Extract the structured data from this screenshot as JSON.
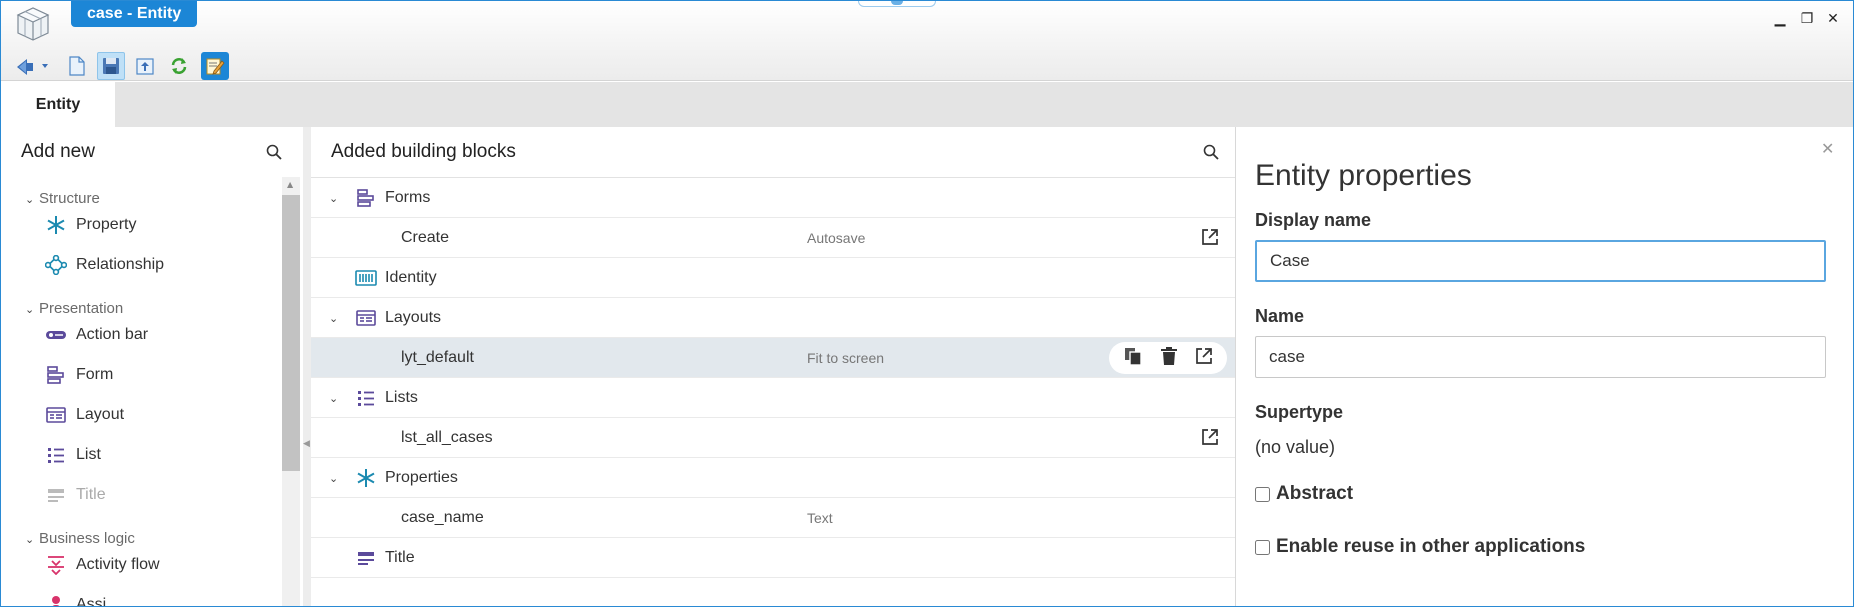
{
  "window": {
    "title": "case - Entity",
    "controls": {
      "minimize": "▁",
      "restore": "❐",
      "close": "✕"
    }
  },
  "toolbar": {
    "buttons": [
      {
        "name": "back-dropdown",
        "icon": "navigate-back-icon"
      },
      {
        "name": "new",
        "icon": "new-document-icon"
      },
      {
        "name": "save",
        "icon": "save-icon"
      },
      {
        "name": "export",
        "icon": "export-icon"
      },
      {
        "name": "refresh",
        "icon": "refresh-icon"
      },
      {
        "name": "edit",
        "icon": "edit-icon"
      }
    ]
  },
  "tabs": [
    {
      "label": "Entity",
      "active": true
    }
  ],
  "left_panel": {
    "title": "Add new",
    "sections": [
      {
        "label": "Structure",
        "items": [
          {
            "label": "Property",
            "icon": "asterisk-icon"
          },
          {
            "label": "Relationship",
            "icon": "relationship-icon"
          }
        ]
      },
      {
        "label": "Presentation",
        "items": [
          {
            "label": "Action bar",
            "icon": "action-bar-icon"
          },
          {
            "label": "Form",
            "icon": "form-icon"
          },
          {
            "label": "Layout",
            "icon": "layout-icon"
          },
          {
            "label": "List",
            "icon": "list-icon"
          },
          {
            "label": "Title",
            "icon": "title-icon",
            "disabled": true
          }
        ]
      },
      {
        "label": "Business logic",
        "items": [
          {
            "label": "Activity flow",
            "icon": "activity-flow-icon"
          },
          {
            "label": "Assi...",
            "icon": "assignment-icon"
          }
        ]
      }
    ]
  },
  "middle_panel": {
    "title": "Added building blocks",
    "groups": [
      {
        "label": "Forms",
        "icon": "form-icon",
        "children": [
          {
            "label": "Create",
            "type": "Autosave",
            "open": true
          }
        ]
      },
      {
        "label": "Identity",
        "icon": "identity-icon",
        "children": []
      },
      {
        "label": "Layouts",
        "icon": "layout-icon",
        "children": [
          {
            "label": "lyt_default",
            "type": "Fit to screen",
            "highlighted": true,
            "actions": [
              "copy-icon",
              "trash-icon",
              "open-external-icon"
            ]
          }
        ]
      },
      {
        "label": "Lists",
        "icon": "list-icon",
        "children": [
          {
            "label": "lst_all_cases",
            "type": "",
            "open": true
          }
        ]
      },
      {
        "label": "Properties",
        "icon": "asterisk-icon",
        "children": [
          {
            "label": "case_name",
            "type": "Text"
          }
        ]
      },
      {
        "label": "Title",
        "icon": "title-icon",
        "children": []
      }
    ]
  },
  "right_panel": {
    "title": "Entity properties",
    "display_name_label": "Display name",
    "display_name_value": "Case",
    "name_label": "Name",
    "name_value": "case",
    "supertype_label": "Supertype",
    "supertype_value": "(no value)",
    "abstract_label": "Abstract",
    "abstract_checked": false,
    "reuse_label": "Enable reuse in other applications",
    "reuse_checked": false,
    "close": "✕"
  },
  "colors": {
    "accent": "#1c86d6",
    "purple_icon": "#5b4a9b",
    "teal_icon": "#1b8ab0",
    "highlight_row": "#e2e8ed"
  }
}
